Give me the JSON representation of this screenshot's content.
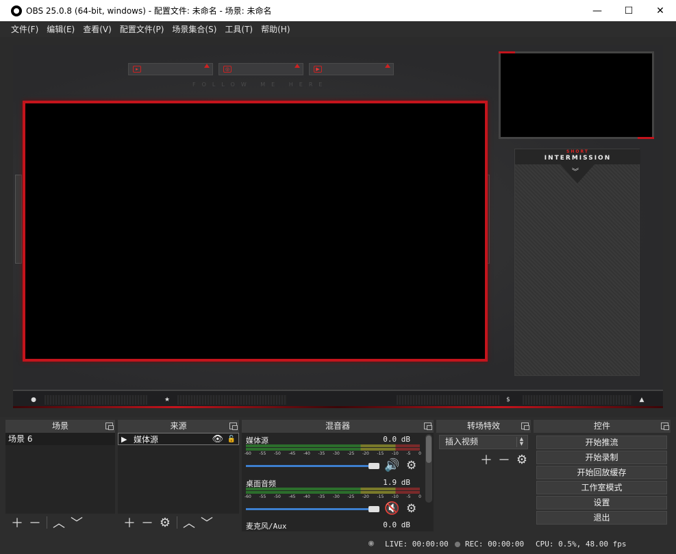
{
  "window": {
    "title": "OBS 25.0.8 (64-bit, windows) - 配置文件: 未命名 - 场景: 未命名",
    "minimize": "—",
    "maximize": "☐",
    "close": "✕"
  },
  "menu": [
    "文件(F)",
    "编辑(E)",
    "查看(V)",
    "配置文件(P)",
    "场景集合(S)",
    "工具(T)",
    "帮助(H)"
  ],
  "preview": {
    "follow_text": "FOLLOW ME HERE",
    "intermission_short": "SHORT",
    "intermission_title": "INTERMISSION",
    "chevrons": "︾",
    "accent_color": "#c4141c",
    "social_icons": [
      "twitter-icon",
      "instagram-icon",
      "youtube-icon"
    ]
  },
  "docks": {
    "scenes": {
      "title": "场景",
      "items": [
        "场景 6"
      ]
    },
    "sources": {
      "title": "来源",
      "items": [
        "媒体源"
      ]
    },
    "mixer": {
      "title": "混音器",
      "ticks": [
        "-60",
        "-55",
        "-50",
        "-45",
        "-40",
        "-35",
        "-30",
        "-25",
        "-20",
        "-15",
        "-10",
        "-5",
        "0"
      ],
      "channels": [
        {
          "name": "媒体源",
          "db": "0.0 dB",
          "muted": false
        },
        {
          "name": "桌面音频",
          "db": "1.9 dB",
          "muted": true
        },
        {
          "name": "麦克风/Aux",
          "db": "0.0 dB",
          "muted": false
        }
      ]
    },
    "transitions": {
      "title": "转场特效",
      "selected": "插入视频"
    },
    "controls": {
      "title": "控件",
      "buttons": [
        "开始推流",
        "开始录制",
        "开始回放缓存",
        "工作室模式",
        "设置",
        "退出"
      ]
    }
  },
  "status": {
    "live": "LIVE: 00:00:00",
    "rec": "REC: 00:00:00",
    "cpu": "CPU: 0.5%, 48.00 fps"
  }
}
